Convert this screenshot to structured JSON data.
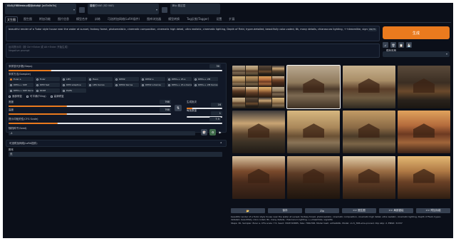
{
  "top": {
    "model": {
      "label": "Stable Diffusion 模型(ckpt)",
      "value": "v1-5_768-ema-pruned.ckpt [ad3a0b3b]"
    },
    "vae": {
      "label": "模型的VAE (SD VAE)",
      "value": "自动"
    },
    "clip": {
      "label": "Clip 跳过层",
      "value": "2"
    }
  },
  "tabs": [
    "文生图",
    "图生图",
    "附加功能",
    "图片信息",
    "模型合并",
    "训练",
    "可选附加网络(LoRA插件)",
    "图库浏览器",
    "模型转换",
    "Tag反推(Tagger)",
    "设置",
    "扩展"
  ],
  "prompt": {
    "positive": "beautiful render of a Tudor style house near the water at sunset, fantasy forest, photorealistic, cinematic composition, cinematic high detail, ultra realistic, cinematic lighting, Depth of Field, hyper-detailed, beautifully color-coded, 8k, many details, chiaroscuro lighting, ++dreamlike, vignette",
    "counter": "69/75",
    "negative_placeholder": "反向提示词（按 Ctrl+Enter 或 Alt+Enter 开始生成）",
    "negative_sub": "Negative prompt"
  },
  "generate": {
    "label": "生成"
  },
  "tools": [
    "↙",
    "🗑",
    "📋",
    "💾"
  ],
  "style": {
    "label": "模板风格"
  },
  "params": {
    "steps": {
      "label": "采样迭代步数(Steps)",
      "value": "30",
      "fraction": 0.2
    },
    "sampler_label": "采样方法(Sampler)",
    "samplers": [
      "Euler a",
      "Euler",
      "LMS",
      "Heun",
      "DPM2",
      "DPM2 a",
      "DPM++ 2S a",
      "DPM++ 2M",
      "DPM++ SDE",
      "DPM fast",
      "DPM adaptive",
      "LMS Karras",
      "DPM2 Karras",
      "DPM2 a Karras",
      "DPM++ 2S a Karras",
      "DPM++ 2M Karras",
      "DPM++ SDE Karras",
      "DDIM",
      "PLMS"
    ],
    "selected_sampler": "Euler a",
    "checks": [
      "面部修复",
      "可平铺(Tiling)",
      "高清修复"
    ],
    "width": {
      "label": "宽度",
      "value": "768",
      "fraction": 0.36
    },
    "height": {
      "label": "高度",
      "value": "768",
      "fraction": 0.36
    },
    "batch_count": {
      "label": "生成批次",
      "value": "16",
      "fraction": 0.16
    },
    "batch_size": {
      "label": "每批数量",
      "value": "1",
      "fraction": 0.0
    },
    "cfg": {
      "label": "提示词相关性(CFG Scale)",
      "value": "7.5",
      "fraction": 0.23
    },
    "seed": {
      "label": "随机种子(Seed)",
      "value": "-1"
    },
    "swap_icon": "⇅",
    "dice_icon": "🎲",
    "recycle_icon": "♻",
    "extra_icon": "▶",
    "lora_section": "可选附加网络(LoRA插件)",
    "script": {
      "label": "脚本",
      "value": "无"
    }
  },
  "gallery": {
    "thumbs": [
      {
        "variant": "grid"
      },
      {
        "variant": "lake"
      },
      {
        "variant": "house"
      },
      {
        "variant": "house-dark"
      },
      {
        "variant": "house-night"
      },
      {
        "variant": "house-lake"
      },
      {
        "variant": "house-warm"
      },
      {
        "variant": "house-red"
      },
      {
        "variant": "roofs"
      },
      {
        "variant": "roofs-dark"
      },
      {
        "variant": "roofs-light"
      },
      {
        "variant": "roofs-gold"
      }
    ],
    "selected_index": 1
  },
  "actions": [
    "📂",
    "保存",
    "Zip",
    ">> 图生图",
    ">> 局部重绘",
    ">> 附加功能"
  ],
  "info": {
    "text": "beautiful render of a Tudor style house near the water at sunset, fantasy forest, photorealistic, cinematic composition, cinematic high detail, ultra realistic, cinematic lighting, Depth of Field, hyper-detailed, beautifully color-coded, 8k, many details, chiaroscuro lighting, ++dreamlike, vignette",
    "meta": "Steps: 30, Sampler: Euler a, CFG scale: 7.5, Seed: 3303743885, Size: 768x768, Model hash: ad3a0b3b, Model: v1-5_768-ema-pruned, Clip skip: 2, ENSD: 31337"
  },
  "colors": {
    "accent": "#ea7a1e",
    "bg": "#0b0f19",
    "panel": "#111827"
  }
}
